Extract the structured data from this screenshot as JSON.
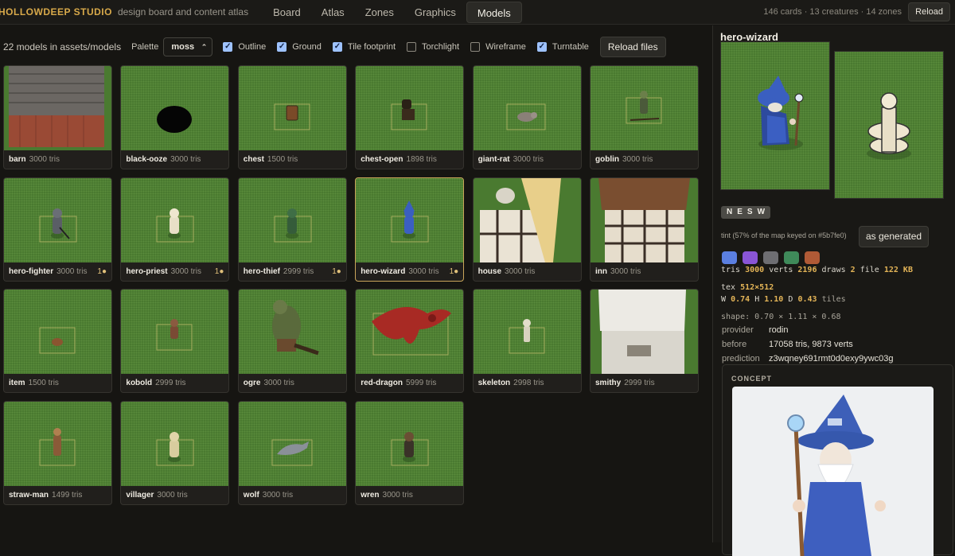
{
  "header": {
    "brand": "HOLLOWDEEP STUDIO",
    "tagline": "design board and content atlas",
    "tabs": [
      {
        "label": "Board"
      },
      {
        "label": "Atlas"
      },
      {
        "label": "Zones"
      },
      {
        "label": "Graphics"
      },
      {
        "label": "Models",
        "active": true
      }
    ],
    "stats": "146 cards · 13 creatures · 14 zones",
    "reload_label": "Reload"
  },
  "toolbar": {
    "count": "22 models in assets/models",
    "palette_label": "Palette",
    "palette_value": "moss",
    "checkboxes": [
      {
        "label": "Outline",
        "checked": true
      },
      {
        "label": "Ground",
        "checked": true
      },
      {
        "label": "Tile footprint",
        "checked": true
      },
      {
        "label": "Torchlight",
        "checked": false
      },
      {
        "label": "Wireframe",
        "checked": false
      },
      {
        "label": "Turntable",
        "checked": true
      }
    ],
    "reload_files_label": "Reload files"
  },
  "models": [
    {
      "name": "barn",
      "tris": "3000 tris",
      "badge": "",
      "icon": "barn-icon"
    },
    {
      "name": "black-ooze",
      "tris": "3000 tris",
      "badge": "",
      "icon": "ooze-icon"
    },
    {
      "name": "chest",
      "tris": "1500 tris",
      "badge": "",
      "icon": "chest-icon"
    },
    {
      "name": "chest-open",
      "tris": "1898 tris",
      "badge": "",
      "icon": "chest-open-icon"
    },
    {
      "name": "giant-rat",
      "tris": "3000 tris",
      "badge": "",
      "icon": "rat-icon"
    },
    {
      "name": "goblin",
      "tris": "3000 tris",
      "badge": "",
      "icon": "goblin-icon"
    },
    {
      "name": "hero-fighter",
      "tris": "3000 tris",
      "badge": "1●",
      "icon": "fighter-icon"
    },
    {
      "name": "hero-priest",
      "tris": "3000 tris",
      "badge": "1●",
      "icon": "priest-icon"
    },
    {
      "name": "hero-thief",
      "tris": "2999 tris",
      "badge": "1●",
      "icon": "thief-icon"
    },
    {
      "name": "hero-wizard",
      "tris": "3000 tris",
      "badge": "1●",
      "icon": "wizard-icon",
      "selected": true
    },
    {
      "name": "house",
      "tris": "3000 tris",
      "badge": "",
      "icon": "house-icon"
    },
    {
      "name": "inn",
      "tris": "3000 tris",
      "badge": "",
      "icon": "inn-icon"
    },
    {
      "name": "item",
      "tris": "1500 tris",
      "badge": "",
      "icon": "item-icon"
    },
    {
      "name": "kobold",
      "tris": "2999 tris",
      "badge": "",
      "icon": "kobold-icon"
    },
    {
      "name": "ogre",
      "tris": "3000 tris",
      "badge": "",
      "icon": "ogre-icon"
    },
    {
      "name": "red-dragon",
      "tris": "5999 tris",
      "badge": "",
      "icon": "dragon-icon"
    },
    {
      "name": "skeleton",
      "tris": "2998 tris",
      "badge": "",
      "icon": "skeleton-icon"
    },
    {
      "name": "smithy",
      "tris": "2999 tris",
      "badge": "",
      "icon": "smithy-icon"
    },
    {
      "name": "straw-man",
      "tris": "1499 tris",
      "badge": "",
      "icon": "strawman-icon"
    },
    {
      "name": "villager",
      "tris": "3000 tris",
      "badge": "",
      "icon": "villager-icon"
    },
    {
      "name": "wolf",
      "tris": "3000 tris",
      "badge": "",
      "icon": "wolf-icon"
    },
    {
      "name": "wren",
      "tris": "3000 tris",
      "badge": "",
      "icon": "wren-icon"
    }
  ],
  "detail": {
    "title": "hero-wizard",
    "directions": [
      "N",
      "E",
      "S",
      "W"
    ],
    "tint_text": "tint (57% of the map keyed on #5b7fe0)",
    "as_generated_label": "as generated",
    "swatch_colors": [
      "#5b7fe0",
      "#8a55d6",
      "#6e6e72",
      "#3f8a5a",
      "#b05a36"
    ],
    "stats_line1": [
      {
        "k": "tris",
        "v": "3000"
      },
      {
        "k": "verts",
        "v": "2196"
      },
      {
        "k": "draws",
        "v": "2"
      },
      {
        "k": "file",
        "v": "122 KB"
      }
    ],
    "tex_label": "tex",
    "tex_value": "512×512",
    "dims": [
      {
        "k": "W",
        "v": "0.74"
      },
      {
        "k": "H",
        "v": "1.10"
      },
      {
        "k": "D",
        "v": "0.43"
      }
    ],
    "dims_unit": "tiles",
    "shape": "shape: 0.70 × 1.11 × 0.68",
    "info": [
      {
        "k": "provider",
        "v": "rodin"
      },
      {
        "k": "before",
        "v": "17058 tris, 9873 verts"
      },
      {
        "k": "prediction",
        "v": "z3wqney691rmt0d0exy9ywc03g"
      }
    ],
    "concept_label": "CONCEPT"
  },
  "colors": {
    "accent": "#d8a94a",
    "grass": "#4a7a30",
    "checkbox": "#9ec2ff",
    "selected_border": "#c9a55a"
  }
}
